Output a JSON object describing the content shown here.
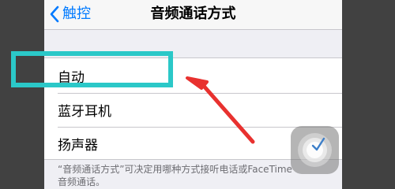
{
  "nav": {
    "back_label": "触控",
    "title": "音频通话方式"
  },
  "options": [
    {
      "label": "自动"
    },
    {
      "label": "蓝牙耳机"
    },
    {
      "label": "扬声器"
    }
  ],
  "footer": {
    "line1": "“音频通话方式”可决定用哪种方式接听电话或FaceTime",
    "line2": "音频通话。"
  },
  "colors": {
    "accent": "#007aff",
    "highlight": "#2bc8c8",
    "arrow": "#e8312f",
    "screen_bg": "#efeff4",
    "outer_bg": "#414141"
  },
  "icons": {
    "back": "chevron-left-icon",
    "assistive_touch": "assistive-touch-icon",
    "check": "checkmark-icon"
  }
}
